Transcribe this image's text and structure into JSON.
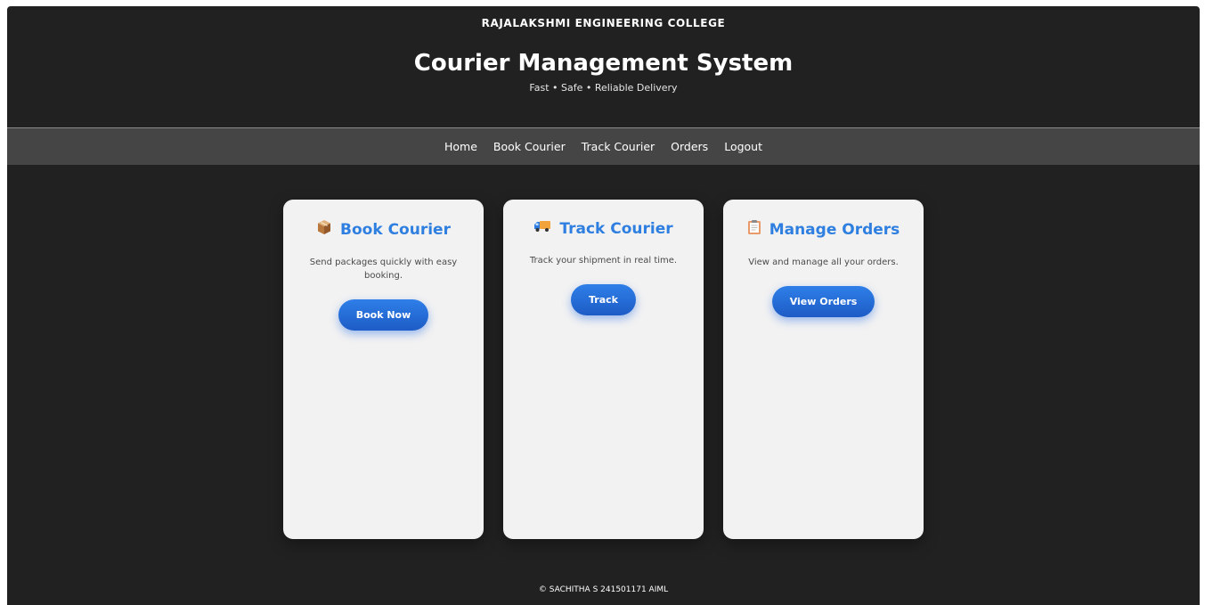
{
  "header": {
    "college": "RAJALAKSHMI ENGINEERING COLLEGE",
    "title": "Courier Management System",
    "tagline": "Fast • Safe • Reliable Delivery"
  },
  "nav": {
    "items": [
      {
        "label": "Home"
      },
      {
        "label": "Book Courier"
      },
      {
        "label": "Track Courier"
      },
      {
        "label": "Orders"
      },
      {
        "label": "Logout"
      }
    ]
  },
  "cards": [
    {
      "icon": "package-icon",
      "title": "Book Courier",
      "description": "Send packages quickly with easy booking.",
      "button": "Book Now"
    },
    {
      "icon": "truck-icon",
      "title": "Track Courier",
      "description": "Track your shipment in real time.",
      "button": "Track"
    },
    {
      "icon": "clipboard-icon",
      "title": "Manage Orders",
      "description": "View and manage all your orders.",
      "button": "View Orders"
    }
  ],
  "footer": {
    "text": "© SACHITHA S 241501171 AIML"
  },
  "colors": {
    "background": "#212121",
    "navbar": "#454545",
    "card": "#f2f2f2",
    "accent": "#2f7fe0"
  }
}
